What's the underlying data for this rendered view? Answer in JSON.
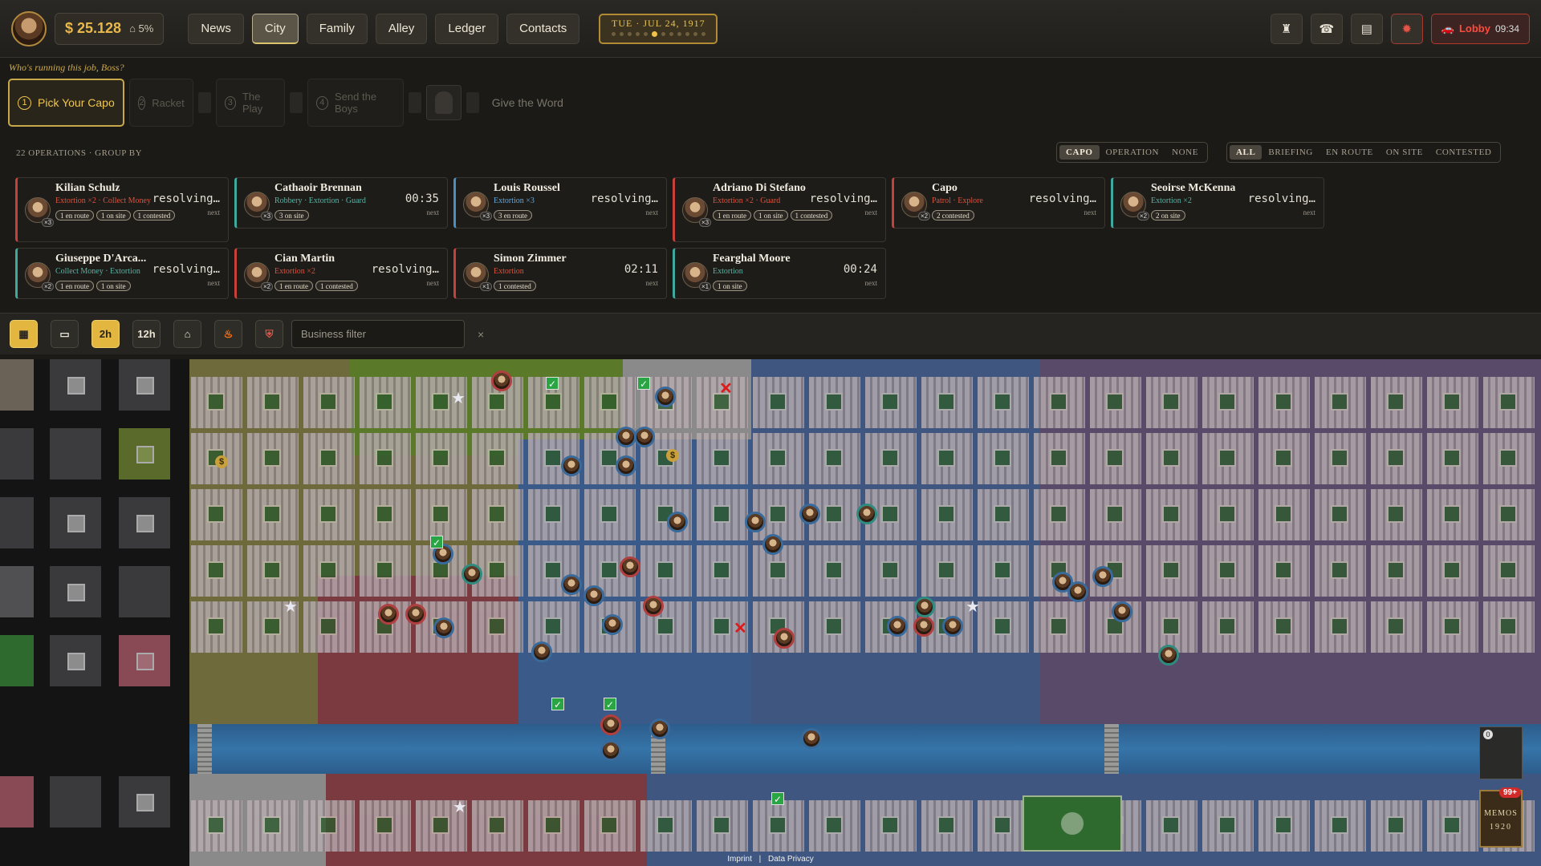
{
  "topbar": {
    "money": "$ 25.128",
    "heat": "5%",
    "nav": [
      {
        "label": "News",
        "active": false
      },
      {
        "label": "City",
        "active": true
      },
      {
        "label": "Family",
        "active": false
      },
      {
        "label": "Alley",
        "active": false
      },
      {
        "label": "Ledger",
        "active": false
      },
      {
        "label": "Contacts",
        "active": false
      }
    ],
    "date": "TUE · JUL 24, 1917",
    "lobby_label": "Lobby",
    "lobby_time": "09:34"
  },
  "wizard": {
    "prompt": "Who's running this job, Boss?",
    "steps": [
      {
        "num": "1",
        "label": "Pick Your Capo"
      },
      {
        "num": "2",
        "label": "Racket"
      },
      {
        "num": "3",
        "label": "The Play"
      },
      {
        "num": "4",
        "label": "Send the Boys"
      }
    ],
    "final": "Give the Word"
  },
  "ops": {
    "heading": "22 OPERATIONS · GROUP BY",
    "group_by": [
      "CAPO",
      "OPERATION",
      "NONE"
    ],
    "filters": [
      "ALL",
      "BRIEFING",
      "EN ROUTE",
      "ON SITE",
      "CONTESTED"
    ],
    "cards": [
      {
        "name": "Kilian Schulz",
        "type": "Extortion ×2 · Collect Money",
        "status": "resolving…",
        "next": "next",
        "badge": "×3",
        "tags": [
          "1 en route",
          "1 on site",
          "1 contested"
        ],
        "color": "red"
      },
      {
        "name": "Cathaoir Brennan",
        "type": "Robbery · Extortion · Guard",
        "status": "00:35",
        "next": "next",
        "badge": "×3",
        "tags": [
          "3 on site"
        ],
        "color": "teal"
      },
      {
        "name": "Louis Roussel",
        "type": "Extortion ×3",
        "status": "resolving…",
        "next": "next",
        "badge": "×3",
        "tags": [
          "3 en route"
        ],
        "color": "blue"
      },
      {
        "name": "Adriano Di Stefano",
        "type": "Extortion ×2 · Guard",
        "status": "resolving…",
        "next": "next",
        "badge": "×3",
        "tags": [
          "1 en route",
          "1 on site",
          "1 contested"
        ],
        "color": "red"
      },
      {
        "name": "Capo",
        "type": "Patrol · Explore",
        "status": "resolving…",
        "next": "next",
        "badge": "×2",
        "tags": [
          "2 contested"
        ],
        "color": "red"
      },
      {
        "name": "Seoirse McKenna",
        "type": "Extortion ×2",
        "status": "resolving…",
        "next": "next",
        "badge": "×2",
        "tags": [
          "2 on site"
        ],
        "color": "teal"
      },
      {
        "name": "Giuseppe D'Arca...",
        "type": "Collect Money · Extortion",
        "status": "resolving…",
        "next": "next",
        "badge": "×2",
        "tags": [
          "1 en route",
          "1 on site"
        ],
        "color": "teal"
      },
      {
        "name": "Cian Martin",
        "type": "Extortion ×2",
        "status": "resolving…",
        "next": "next",
        "badge": "×2",
        "tags": [
          "1 en route",
          "1 contested"
        ],
        "color": "red"
      },
      {
        "name": "Simon Zimmer",
        "type": "Extortion",
        "status": "02:11",
        "next": "next",
        "badge": "×1",
        "tags": [
          "1 contested"
        ],
        "color": "red"
      },
      {
        "name": "Fearghal Moore",
        "type": "Extortion",
        "status": "00:24",
        "next": "next",
        "badge": "×1",
        "tags": [
          "1 on site"
        ],
        "color": "teal"
      }
    ]
  },
  "maptools": {
    "buttons": [
      "map-icon",
      "blueprint-icon",
      "2h",
      "12h",
      "house-icon",
      "fire-icon",
      "shield-icon"
    ],
    "active": "2h",
    "filter_placeholder": "Business filter",
    "clear": "×"
  },
  "map": {
    "memos_title": "MEMOS",
    "memos_year": "1920",
    "memos_badge": "99+",
    "zoom_level": "0"
  },
  "footer": {
    "imprint": "Imprint",
    "sep": "|",
    "privacy": "Data Privacy"
  },
  "colors": {
    "gold": "#e8b84a",
    "red_zone": "#b0404a",
    "blue_zone": "#3a5ea0",
    "green_zone": "#5a7a2a",
    "purple_zone": "#6a4a7a"
  }
}
